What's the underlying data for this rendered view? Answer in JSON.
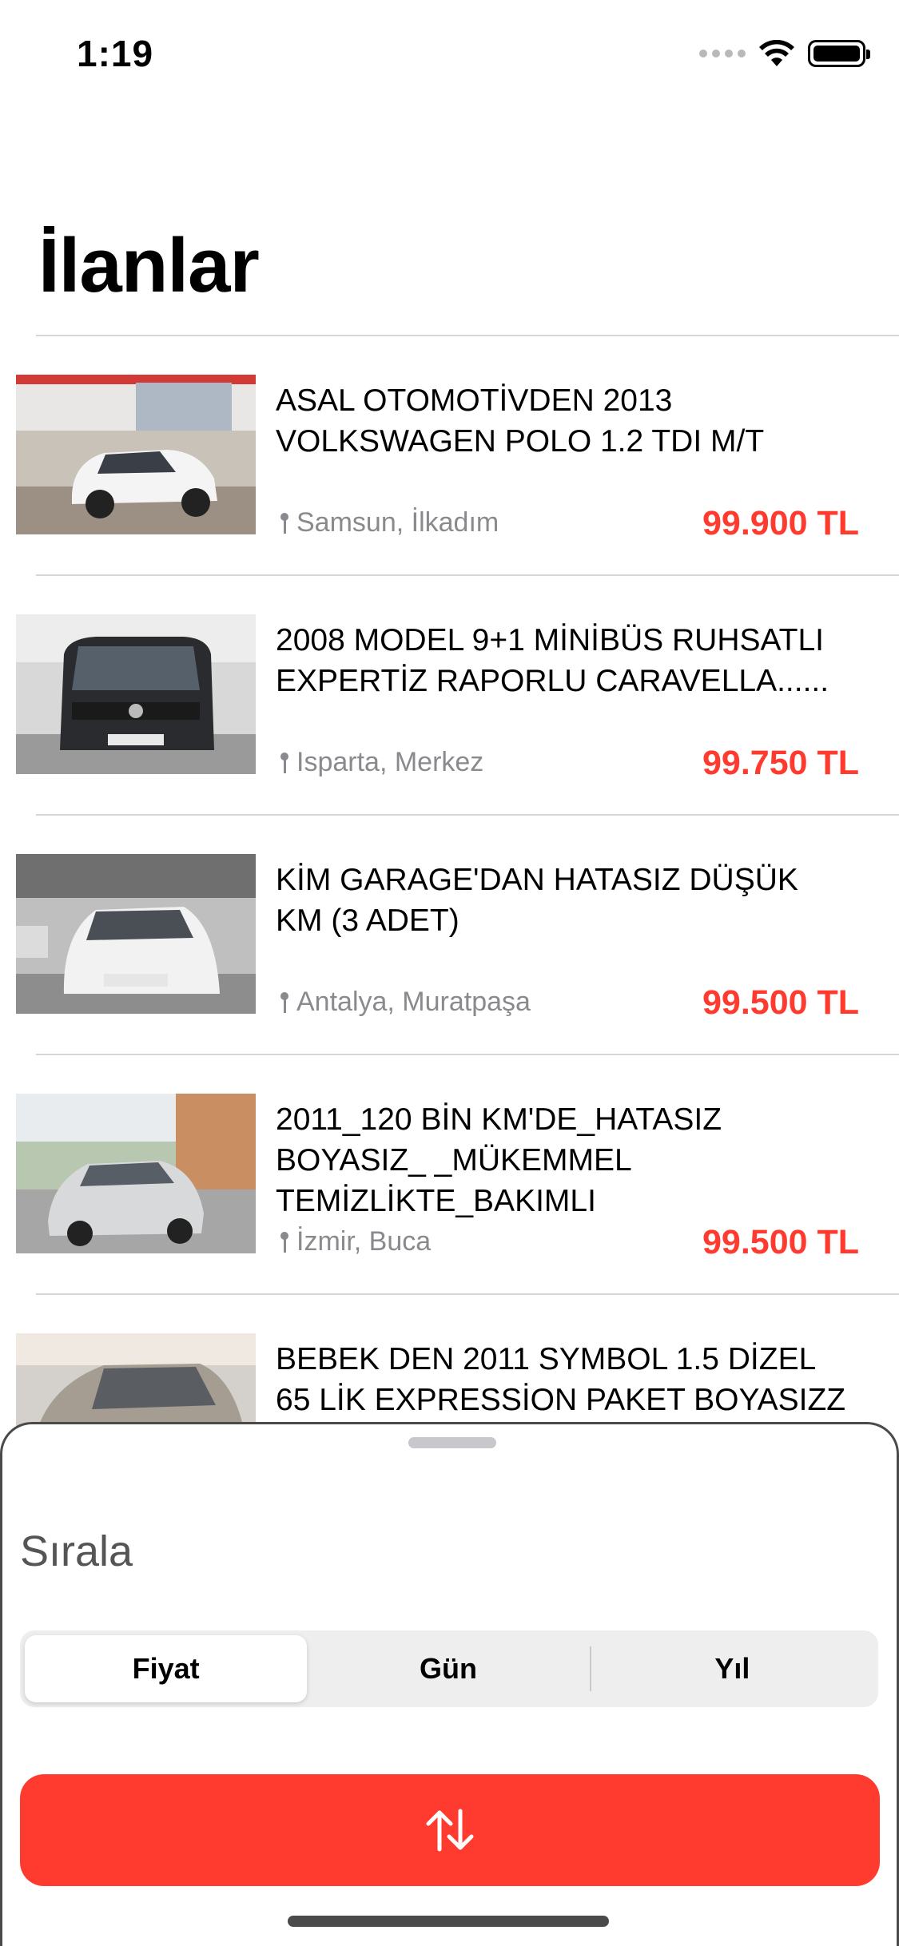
{
  "status": {
    "time": "1:19"
  },
  "page": {
    "title": "İlanlar"
  },
  "listings": [
    {
      "title": "ASAL OTOMOTİVDEN 2013 VOLKSWAGEN POLO 1.2 TDI M/T",
      "location": "Samsun, İlkadım",
      "price": "99.900 TL"
    },
    {
      "title": "2008 MODEL 9+1 MİNİBÜS RUHSATLI EXPERTİZ RAPORLU CARAVELLA......",
      "location": "Isparta, Merkez",
      "price": "99.750 TL"
    },
    {
      "title": "KİM GARAGE'DAN HATASIZ DÜŞÜK KM (3 ADET)",
      "location": "Antalya, Muratpaşa",
      "price": "99.500 TL"
    },
    {
      "title": "2011_120 BİN KM'DE_HATASIZ BOYASIZ_ _MÜKEMMEL TEMİZLİKTE_BAKIMLI",
      "location": "İzmir, Buca",
      "price": "99.500 TL"
    },
    {
      "title": "BEBEK DEN 2011 SYMBOL 1.5 DİZEL 65 LİK EXPRESSİON PAKET BOYASIZZ",
      "location": "",
      "price": ""
    }
  ],
  "sheet": {
    "title": "Sırala",
    "segments": [
      "Fiyat",
      "Gün",
      "Yıl"
    ],
    "selected_segment": "Fiyat",
    "sort_button_icon": "sort-arrows-icon"
  },
  "colors": {
    "accent": "#ff3b30",
    "secondary_text": "#8a8a8e"
  }
}
